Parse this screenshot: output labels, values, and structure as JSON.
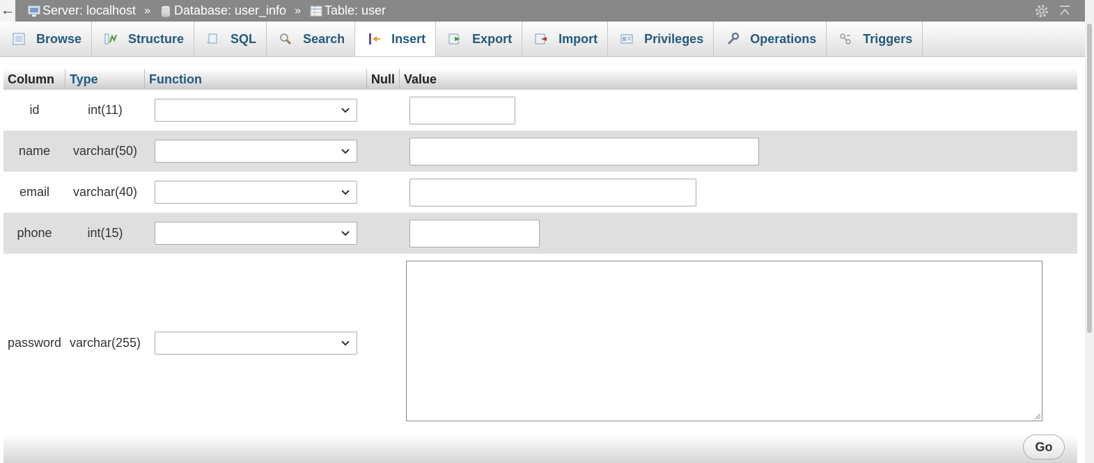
{
  "breadcrumb": {
    "back_glyph": "←",
    "server_label": "Server: localhost",
    "database_label": "Database: user_info",
    "table_label": "Table: user",
    "separator": "»"
  },
  "tabs": [
    {
      "label": "Browse",
      "icon": "browse-icon"
    },
    {
      "label": "Structure",
      "icon": "structure-icon"
    },
    {
      "label": "SQL",
      "icon": "sql-icon"
    },
    {
      "label": "Search",
      "icon": "search-icon"
    },
    {
      "label": "Insert",
      "icon": "insert-icon",
      "active": true
    },
    {
      "label": "Export",
      "icon": "export-icon"
    },
    {
      "label": "Import",
      "icon": "import-icon"
    },
    {
      "label": "Privileges",
      "icon": "privileges-icon"
    },
    {
      "label": "Operations",
      "icon": "operations-icon"
    },
    {
      "label": "Triggers",
      "icon": "triggers-icon"
    }
  ],
  "table_header": {
    "column": "Column",
    "type": "Type",
    "function": "Function",
    "null": "Null",
    "value": "Value"
  },
  "rows": [
    {
      "column": "id",
      "type": "int(11)",
      "function": "",
      "value": ""
    },
    {
      "column": "name",
      "type": "varchar(50)",
      "function": "",
      "value": ""
    },
    {
      "column": "email",
      "type": "varchar(40)",
      "function": "",
      "value": ""
    },
    {
      "column": "phone",
      "type": "int(15)",
      "function": "",
      "value": ""
    },
    {
      "column": "password",
      "type": "varchar(255)",
      "function": "",
      "value": ""
    }
  ],
  "footer": {
    "go_label": "Go"
  },
  "colors": {
    "link": "#235a81",
    "topbar": "#888888",
    "row_alt": "#dfdfdf"
  }
}
